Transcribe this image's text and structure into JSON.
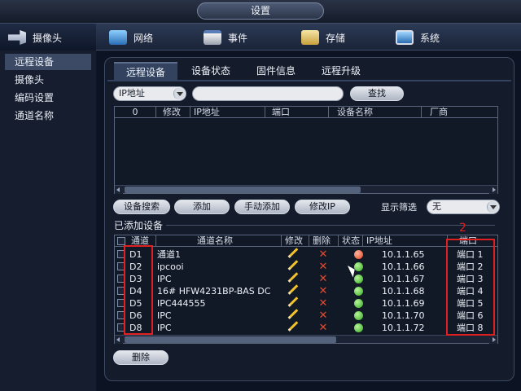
{
  "window": {
    "title": "设置"
  },
  "menu": {
    "items": [
      {
        "label": "摄像头",
        "icon": "camera-icon",
        "active": true
      },
      {
        "label": "网络",
        "icon": "network-icon"
      },
      {
        "label": "事件",
        "icon": "event-icon"
      },
      {
        "label": "存储",
        "icon": "storage-icon"
      },
      {
        "label": "系统",
        "icon": "system-icon"
      }
    ]
  },
  "sidebar": {
    "items": [
      {
        "label": "远程设备",
        "active": true
      },
      {
        "label": "摄像头"
      },
      {
        "label": "编码设置"
      },
      {
        "label": "通道名称"
      }
    ]
  },
  "tabs": [
    {
      "label": "远程设备",
      "active": true
    },
    {
      "label": "设备状态"
    },
    {
      "label": "固件信息"
    },
    {
      "label": "远程升级"
    }
  ],
  "search": {
    "type_value": "IP地址",
    "input_value": "",
    "button_label": "查找"
  },
  "discover_table": {
    "headers": [
      "0",
      "修改",
      "IP地址",
      "端口",
      "设备名称",
      "厂商"
    ]
  },
  "actions": {
    "device_search": "设备搜索",
    "add": "添加",
    "manual_add": "手动添加",
    "modify_ip": "修改IP",
    "filter_label": "显示筛选",
    "filter_value": "无"
  },
  "added_section": {
    "label": "已添加设备"
  },
  "added_table": {
    "headers": [
      "通道",
      "通道名称",
      "修改",
      "删除",
      "状态",
      "IP地址",
      "端口"
    ],
    "rows": [
      {
        "channel": "D1",
        "name": "通道1",
        "status": "red",
        "ip": "10.1.1.65",
        "port": "端口 1"
      },
      {
        "channel": "D2",
        "name": "ipcooi",
        "status": "green",
        "ip": "10.1.1.66",
        "port": "端口 2"
      },
      {
        "channel": "D3",
        "name": "IPC",
        "status": "green",
        "ip": "10.1.1.67",
        "port": "端口 3"
      },
      {
        "channel": "D4",
        "name": "16# HFW4231BP-BAS DC",
        "status": "green",
        "ip": "10.1.1.68",
        "port": "端口 4"
      },
      {
        "channel": "D5",
        "name": "IPC444555",
        "status": "green",
        "ip": "10.1.1.69",
        "port": "端口 5"
      },
      {
        "channel": "D6",
        "name": "IPC",
        "status": "green",
        "ip": "10.1.1.70",
        "port": "端口 6"
      },
      {
        "channel": "D8",
        "name": "IPC",
        "status": "green",
        "ip": "10.1.1.72",
        "port": "端口 8"
      }
    ]
  },
  "delete_button": "删除",
  "annotation": {
    "number": "2",
    "color": "#e02020"
  }
}
